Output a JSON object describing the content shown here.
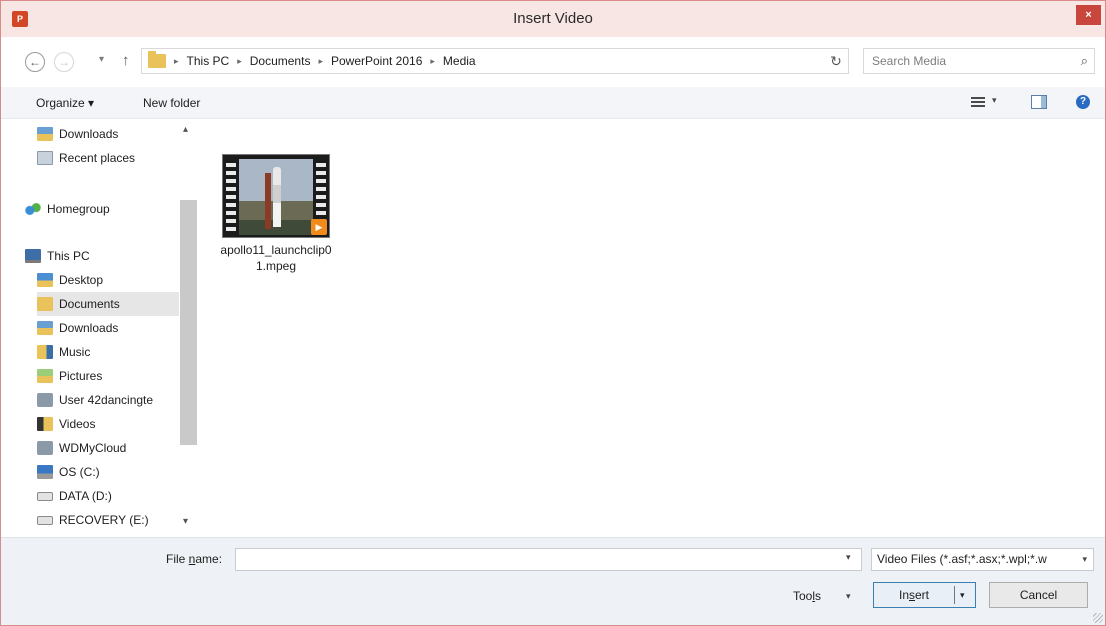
{
  "window": {
    "title": "Insert Video",
    "close_label": "×",
    "app_icon_text": "P"
  },
  "nav": {
    "back": "←",
    "forward": "→",
    "recent_dropdown": "▾",
    "up": "↑",
    "breadcrumb": [
      "This PC",
      "Documents",
      "PowerPoint 2016",
      "Media"
    ],
    "separator": "▸",
    "address_dropdown": "▾",
    "refresh": "↻",
    "search_placeholder": "Search Media",
    "search_icon": "⌕"
  },
  "toolbar": {
    "organize": "Organize ▾",
    "new_folder": "New folder",
    "view_dropdown": "▾",
    "help": "?"
  },
  "sidebar": {
    "items": [
      {
        "label": "Downloads",
        "icon": "download-folder-icon"
      },
      {
        "label": "Recent places",
        "icon": "recent-places-icon"
      },
      {
        "label": "Homegroup",
        "icon": "homegroup-icon"
      },
      {
        "label": "This PC",
        "icon": "computer-icon"
      },
      {
        "label": "Desktop",
        "icon": "desktop-icon"
      },
      {
        "label": "Documents",
        "icon": "documents-folder-icon",
        "selected": true
      },
      {
        "label": "Downloads",
        "icon": "download-folder-icon"
      },
      {
        "label": "Music",
        "icon": "music-folder-icon"
      },
      {
        "label": "Pictures",
        "icon": "pictures-folder-icon"
      },
      {
        "label": "User 42dancingte",
        "icon": "network-location-icon"
      },
      {
        "label": "Videos",
        "icon": "videos-folder-icon"
      },
      {
        "label": "WDMyCloud",
        "icon": "network-location-icon"
      },
      {
        "label": "OS (C:)",
        "icon": "os-drive-icon"
      },
      {
        "label": "DATA (D:)",
        "icon": "drive-icon"
      },
      {
        "label": "RECOVERY (E:)",
        "icon": "drive-icon"
      }
    ],
    "scroll_up": "▴",
    "scroll_down": "▾"
  },
  "files": [
    {
      "name": "apollo11_launchclip01.mpeg",
      "play_badge": "▶"
    }
  ],
  "bottom": {
    "file_name_label_prefix": "File ",
    "file_name_label_underlined": "n",
    "file_name_label_suffix": "ame:",
    "file_name_value": "",
    "file_name_dropdown": "▾",
    "file_type": "Video Files (*.asf;*.asx;*.wpl;*.w",
    "file_type_dropdown": "▾",
    "tools_prefix": "Too",
    "tools_underlined": "l",
    "tools_suffix": "s",
    "tools_dropdown": "▾",
    "insert_prefix": "In",
    "insert_underlined": "s",
    "insert_suffix": "ert",
    "insert_dropdown": "▾",
    "cancel": "Cancel"
  }
}
